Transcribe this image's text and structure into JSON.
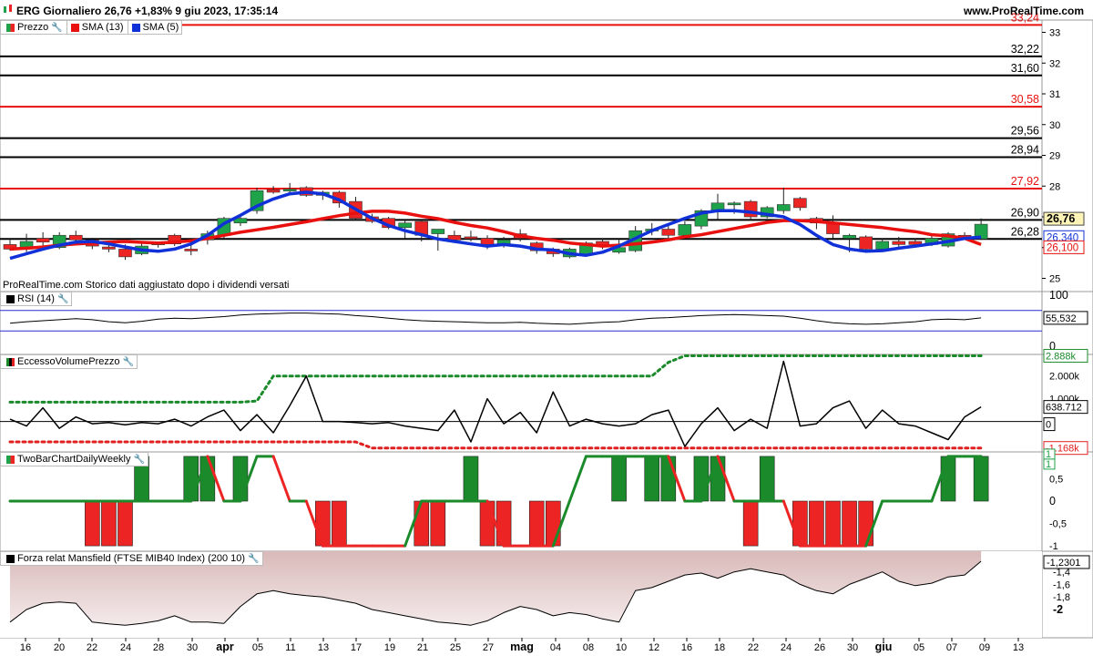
{
  "header": {
    "title": "ERG Giornaliero 26,76 +1,83% 9 giu 2023, 17:35:14",
    "site": "www.ProRealTime.com"
  },
  "panels": {
    "price": {
      "legend": [
        {
          "label": "Prezzo",
          "swatch": "split"
        },
        {
          "label": "SMA (13)",
          "swatch": "#e8110f"
        },
        {
          "label": "SMA (5)",
          "swatch": "#1030d8"
        }
      ],
      "footnote": "ProRealTime.com  Storico dati aggiustato dopo i dividendi versati"
    },
    "rsi": {
      "legend": "RSI (14)"
    },
    "evp": {
      "legend": "EccessoVolumePrezzo"
    },
    "tbc": {
      "legend": "TwoBarChartDailyWeekly"
    },
    "msf": {
      "legend": "Forza relat Mansfield (FTSE MIB40 Index) (200 10)"
    }
  },
  "colors": {
    "up": "#1fa34a",
    "down": "#ec2424",
    "sma13": "#e8110f",
    "sma5": "#1030d8",
    "dotted_green": "#1a8a2a",
    "dotted_red": "#e02020",
    "mansfield_fill": "#d9b9b9",
    "grid_accent": "#2a2ad0"
  },
  "chart_data": [
    {
      "type": "candlestick",
      "title": "ERG Giornaliero",
      "ylim": [
        24.6,
        33.4
      ],
      "y_ticks": [
        "25",
        "26",
        "27",
        "28",
        "29",
        "30",
        "31",
        "32",
        "33"
      ],
      "x_labels": [
        "16",
        "20",
        "22",
        "24",
        "28",
        "30",
        "apr",
        "05",
        "11",
        "13",
        "17",
        "19",
        "21",
        "25",
        "27",
        "mag",
        "04",
        "08",
        "10",
        "12",
        "16",
        "18",
        "22",
        "24",
        "26",
        "30",
        "giu",
        "05",
        "07",
        "09",
        "13"
      ],
      "dates": [
        "03-15",
        "03-16",
        "03-17",
        "03-20",
        "03-21",
        "03-22",
        "03-23",
        "03-24",
        "03-27",
        "03-28",
        "03-29",
        "03-30",
        "03-31",
        "04-03",
        "04-04",
        "04-05",
        "04-06",
        "04-11",
        "04-12",
        "04-13",
        "04-14",
        "04-17",
        "04-18",
        "04-19",
        "04-20",
        "04-21",
        "04-24",
        "04-25",
        "04-26",
        "04-27",
        "04-28",
        "05-02",
        "05-03",
        "05-04",
        "05-05",
        "05-08",
        "05-09",
        "05-10",
        "05-11",
        "05-12",
        "05-15",
        "05-16",
        "05-17",
        "05-18",
        "05-19",
        "05-22",
        "05-23",
        "05-24",
        "05-25",
        "05-26",
        "05-29",
        "05-30",
        "05-31",
        "06-01",
        "06-02",
        "06-05",
        "06-06",
        "06-07",
        "06-08",
        "06-09"
      ],
      "ohlc": [
        [
          26.1,
          26.25,
          25.9,
          25.95
        ],
        [
          25.95,
          26.45,
          25.85,
          26.2
        ],
        [
          26.3,
          26.5,
          26.05,
          26.18
        ],
        [
          26.0,
          26.5,
          25.95,
          26.4
        ],
        [
          26.4,
          26.55,
          26.1,
          26.25
        ],
        [
          26.25,
          26.32,
          25.95,
          26.05
        ],
        [
          26.02,
          26.2,
          25.85,
          25.95
        ],
        [
          25.95,
          26.1,
          25.6,
          25.7
        ],
        [
          25.8,
          26.15,
          25.75,
          26.05
        ],
        [
          26.1,
          26.2,
          26.0,
          26.15
        ],
        [
          26.4,
          26.45,
          26.05,
          26.12
        ],
        [
          25.95,
          26.1,
          25.75,
          25.9
        ],
        [
          26.25,
          26.55,
          26.1,
          26.45
        ],
        [
          26.4,
          27.0,
          26.3,
          26.95
        ],
        [
          26.8,
          27.0,
          26.7,
          26.95
        ],
        [
          27.2,
          27.95,
          27.1,
          27.85
        ],
        [
          27.88,
          28.0,
          27.75,
          27.8
        ],
        [
          27.85,
          28.1,
          27.7,
          27.9
        ],
        [
          27.95,
          28.0,
          27.65,
          27.7
        ],
        [
          27.7,
          27.85,
          27.55,
          27.8
        ],
        [
          27.8,
          27.85,
          27.3,
          27.45
        ],
        [
          27.5,
          27.65,
          26.9,
          26.95
        ],
        [
          27.0,
          27.1,
          26.8,
          26.85
        ],
        [
          26.95,
          27.0,
          26.6,
          26.65
        ],
        [
          26.65,
          26.9,
          26.3,
          26.8
        ],
        [
          26.85,
          26.9,
          26.2,
          26.4
        ],
        [
          26.45,
          26.55,
          25.9,
          26.6
        ],
        [
          26.4,
          26.55,
          26.2,
          26.25
        ],
        [
          26.35,
          26.55,
          26.2,
          26.3
        ],
        [
          26.3,
          26.4,
          25.95,
          26.1
        ],
        [
          26.1,
          26.35,
          26.0,
          26.25
        ],
        [
          26.45,
          26.6,
          26.2,
          26.3
        ],
        [
          26.15,
          26.2,
          25.8,
          25.9
        ],
        [
          25.95,
          26.0,
          25.7,
          25.8
        ],
        [
          25.7,
          26.0,
          25.65,
          25.95
        ],
        [
          25.75,
          26.2,
          25.7,
          26.15
        ],
        [
          26.2,
          26.3,
          25.95,
          26.05
        ],
        [
          25.85,
          26.25,
          25.8,
          26.0
        ],
        [
          25.9,
          26.7,
          25.85,
          26.55
        ],
        [
          26.55,
          26.8,
          26.4,
          26.6
        ],
        [
          26.6,
          26.75,
          26.3,
          26.4
        ],
        [
          26.4,
          26.85,
          26.3,
          26.75
        ],
        [
          26.7,
          27.25,
          26.6,
          27.2
        ],
        [
          27.2,
          27.75,
          26.9,
          27.45
        ],
        [
          27.4,
          27.5,
          27.1,
          27.45
        ],
        [
          27.5,
          27.55,
          26.9,
          27.0
        ],
        [
          27.0,
          27.35,
          26.95,
          27.3
        ],
        [
          27.2,
          27.95,
          27.1,
          27.4
        ],
        [
          27.6,
          27.65,
          27.2,
          27.3
        ],
        [
          26.95,
          27.0,
          26.6,
          26.8
        ],
        [
          26.8,
          27.05,
          26.3,
          26.45
        ],
        [
          26.3,
          26.45,
          25.85,
          26.4
        ],
        [
          26.35,
          26.4,
          25.85,
          25.95
        ],
        [
          25.95,
          26.3,
          25.9,
          26.2
        ],
        [
          26.2,
          26.35,
          26.0,
          26.1
        ],
        [
          26.2,
          26.3,
          26.0,
          26.1
        ],
        [
          26.1,
          26.4,
          26.05,
          26.3
        ],
        [
          26.05,
          26.5,
          26.0,
          26.45
        ],
        [
          26.4,
          26.5,
          26.25,
          26.3
        ],
        [
          26.28,
          26.95,
          26.25,
          26.76
        ]
      ],
      "sma13": [
        25.95,
        25.98,
        26.02,
        26.08,
        26.12,
        26.15,
        26.18,
        26.2,
        26.17,
        26.15,
        26.18,
        26.22,
        26.3,
        26.4,
        26.5,
        26.58,
        26.66,
        26.75,
        26.84,
        26.94,
        27.04,
        27.12,
        27.18,
        27.18,
        27.12,
        27.02,
        26.94,
        26.82,
        26.72,
        26.64,
        26.52,
        26.38,
        26.3,
        26.24,
        26.15,
        26.1,
        26.05,
        26.08,
        26.12,
        26.18,
        26.25,
        26.35,
        26.42,
        26.52,
        26.62,
        26.72,
        26.82,
        26.88,
        26.88,
        26.85,
        26.8,
        26.75,
        26.7,
        26.65,
        26.58,
        26.52,
        26.42,
        26.38,
        26.3,
        26.1
      ],
      "sma5": [
        25.65,
        25.8,
        25.95,
        26.08,
        26.18,
        26.2,
        26.12,
        26.02,
        25.92,
        25.88,
        25.95,
        26.12,
        26.4,
        26.78,
        27.05,
        27.35,
        27.58,
        27.75,
        27.8,
        27.75,
        27.55,
        27.25,
        26.95,
        26.72,
        26.55,
        26.42,
        26.28,
        26.2,
        26.12,
        26.05,
        26.1,
        26.05,
        25.95,
        25.92,
        25.8,
        25.75,
        25.85,
        26.05,
        26.3,
        26.55,
        26.75,
        26.95,
        27.12,
        27.2,
        27.2,
        27.15,
        27.08,
        27.0,
        26.75,
        26.4,
        26.1,
        25.95,
        25.88,
        25.9,
        25.98,
        26.05,
        26.12,
        26.2,
        26.3,
        26.34
      ],
      "horizontal_levels": [
        {
          "value": 33.24,
          "label": "33,24",
          "color": "#e8110f"
        },
        {
          "value": 32.22,
          "label": "32,22",
          "color": "#000000"
        },
        {
          "value": 31.6,
          "label": "31,60",
          "color": "#000000"
        },
        {
          "value": 30.58,
          "label": "30,58",
          "color": "#e8110f"
        },
        {
          "value": 29.56,
          "label": "29,56",
          "color": "#000000"
        },
        {
          "value": 28.94,
          "label": "28,94",
          "color": "#000000"
        },
        {
          "value": 27.92,
          "label": "27,92",
          "color": "#e8110f"
        },
        {
          "value": 26.9,
          "label": "26,90",
          "color": "#000000"
        },
        {
          "value": 26.28,
          "label": "26,28",
          "color": "#000000"
        }
      ],
      "last_labels": [
        {
          "value": 26.76,
          "label": "26,76",
          "kind": "price"
        },
        {
          "value": 26.34,
          "label": "26,340",
          "kind": "sma5"
        },
        {
          "value": 26.1,
          "label": "26,100",
          "kind": "sma13"
        }
      ]
    },
    {
      "type": "line",
      "title": "RSI (14)",
      "ylim": [
        0,
        100
      ],
      "y_ticks": [
        "0",
        "100"
      ],
      "band": [
        30,
        70
      ],
      "values": [
        45,
        48,
        50,
        52,
        54,
        52,
        48,
        46,
        49,
        53,
        55,
        54,
        56,
        58,
        61,
        63,
        64,
        65,
        65,
        64,
        63,
        60,
        58,
        55,
        52,
        50,
        49,
        48,
        47,
        46,
        46,
        47,
        45,
        44,
        43,
        45,
        47,
        48,
        52,
        55,
        56,
        58,
        60,
        61,
        62,
        61,
        60,
        59,
        55,
        50,
        46,
        44,
        43,
        44,
        46,
        48,
        52,
        53,
        52,
        55.532
      ],
      "last_label": "55,532"
    },
    {
      "type": "line",
      "title": "EccessoVolumePrezzo",
      "ylim": [
        -1300000,
        2950000
      ],
      "y_ticks": [
        "1.000k",
        "2.000k",
        "0"
      ],
      "values": [
        100000,
        -200000,
        600000,
        -300000,
        200000,
        -100000,
        -50000,
        -150000,
        -50000,
        -100000,
        100000,
        -200000,
        200000,
        500000,
        -400000,
        300000,
        -500000,
        700000,
        2000000,
        0,
        0,
        -50000,
        -100000,
        -50000,
        -200000,
        -300000,
        -400000,
        500000,
        -900000,
        1000000,
        -100000,
        400000,
        -500000,
        1300000,
        -200000,
        100000,
        -100000,
        -200000,
        -100000,
        300000,
        500000,
        -1100000,
        -100000,
        600000,
        -400000,
        100000,
        -300000,
        2650000,
        -200000,
        -100000,
        600000,
        900000,
        -300000,
        500000,
        -100000,
        -200000,
        -500000,
        -800000,
        200000,
        638712
      ],
      "dotted_upper": [
        850000,
        850000,
        850000,
        850000,
        850000,
        850000,
        850000,
        850000,
        850000,
        850000,
        850000,
        850000,
        850000,
        850000,
        850000,
        900000,
        2000000,
        2000000,
        2000000,
        2000000,
        2000000,
        2000000,
        2000000,
        2000000,
        2000000,
        2000000,
        2000000,
        2000000,
        2000000,
        2000000,
        2000000,
        2000000,
        2000000,
        2000000,
        2000000,
        2000000,
        2000000,
        2000000,
        2000000,
        2000000,
        2600000,
        2888000,
        2888000,
        2888000,
        2888000,
        2888000,
        2888000,
        2888000,
        2888000,
        2888000,
        2888000,
        2888000,
        2888000,
        2888000,
        2888000,
        2888000,
        2888000,
        2888000,
        2888000,
        2888000
      ],
      "dotted_lower": [
        -900000,
        -900000,
        -900000,
        -900000,
        -900000,
        -900000,
        -900000,
        -900000,
        -900000,
        -900000,
        -900000,
        -900000,
        -900000,
        -900000,
        -900000,
        -900000,
        -900000,
        -900000,
        -900000,
        -900000,
        -900000,
        -900000,
        -1168000,
        -1168000,
        -1168000,
        -1168000,
        -1168000,
        -1168000,
        -1168000,
        -1168000,
        -1168000,
        -1168000,
        -1168000,
        -1168000,
        -1168000,
        -1168000,
        -1168000,
        -1168000,
        -1168000,
        -1168000,
        -1168000,
        -1168000,
        -1168000,
        -1168000,
        -1168000,
        -1168000,
        -1168000,
        -1168000,
        -1168000,
        -1168000,
        -1168000,
        -1168000,
        -1168000,
        -1168000,
        -1168000,
        -1168000,
        -1168000,
        -1168000,
        -1168000,
        -1168000
      ],
      "labels": [
        "2.888k",
        "638.712",
        "0",
        "-1.168k"
      ]
    },
    {
      "type": "bar",
      "title": "TwoBarChartDailyWeekly",
      "ylim": [
        -1.1,
        1.1
      ],
      "y_ticks": [
        "1",
        "0,5",
        "0",
        "-0,5",
        "-1"
      ],
      "daily": [
        0,
        0,
        0,
        0,
        0,
        -1,
        -1,
        -1,
        1,
        0,
        0,
        1,
        1,
        0,
        1,
        0,
        0,
        0,
        0,
        -1,
        -1,
        0,
        0,
        0,
        0,
        -1,
        -1,
        0,
        1,
        -1,
        -1,
        0,
        -1,
        -1,
        0,
        0,
        0,
        1,
        0,
        1,
        1,
        0,
        1,
        1,
        0,
        -1,
        1,
        0,
        -1,
        -1,
        -1,
        -1,
        -1,
        0,
        0,
        0,
        0,
        1,
        0,
        1
      ],
      "weekly": [
        0,
        0,
        0,
        0,
        0,
        0,
        0,
        0,
        0,
        0,
        0,
        0,
        1,
        0,
        0,
        1,
        1,
        0,
        0,
        -1,
        -1,
        -1,
        -1,
        -1,
        -1,
        0,
        0,
        0,
        0,
        0,
        -1,
        -1,
        -1,
        -1,
        0,
        1,
        1,
        1,
        1,
        1,
        1,
        0,
        0,
        1,
        0,
        0,
        0,
        0,
        -1,
        -1,
        -1,
        -1,
        -1,
        0,
        0,
        0,
        0,
        1,
        1,
        1
      ],
      "last_labels": [
        "1",
        "1"
      ]
    },
    {
      "type": "area",
      "title": "Forza relat Mansfield (FTSE MIB40 Index) (200 10)",
      "ylim": [
        -2.45,
        -1.1
      ],
      "y_ticks": [
        "-1,4",
        "-1,6",
        "-1,8",
        "-2"
      ],
      "values": [
        -2.2,
        -2.0,
        -1.9,
        -1.88,
        -1.9,
        -2.2,
        -2.23,
        -2.25,
        -2.22,
        -2.18,
        -2.1,
        -2.2,
        -2.2,
        -2.22,
        -1.95,
        -1.75,
        -1.7,
        -1.75,
        -1.78,
        -1.8,
        -1.85,
        -1.9,
        -2.0,
        -2.05,
        -2.1,
        -2.15,
        -2.2,
        -2.22,
        -2.25,
        -2.18,
        -2.05,
        -1.95,
        -2.0,
        -2.1,
        -2.05,
        -2.08,
        -2.15,
        -2.2,
        -1.7,
        -1.65,
        -1.55,
        -1.45,
        -1.42,
        -1.5,
        -1.4,
        -1.35,
        -1.4,
        -1.45,
        -1.6,
        -1.7,
        -1.75,
        -1.6,
        -1.5,
        -1.4,
        -1.55,
        -1.62,
        -1.58,
        -1.48,
        -1.45,
        -1.2301
      ],
      "last_label": "-1,2301"
    }
  ]
}
